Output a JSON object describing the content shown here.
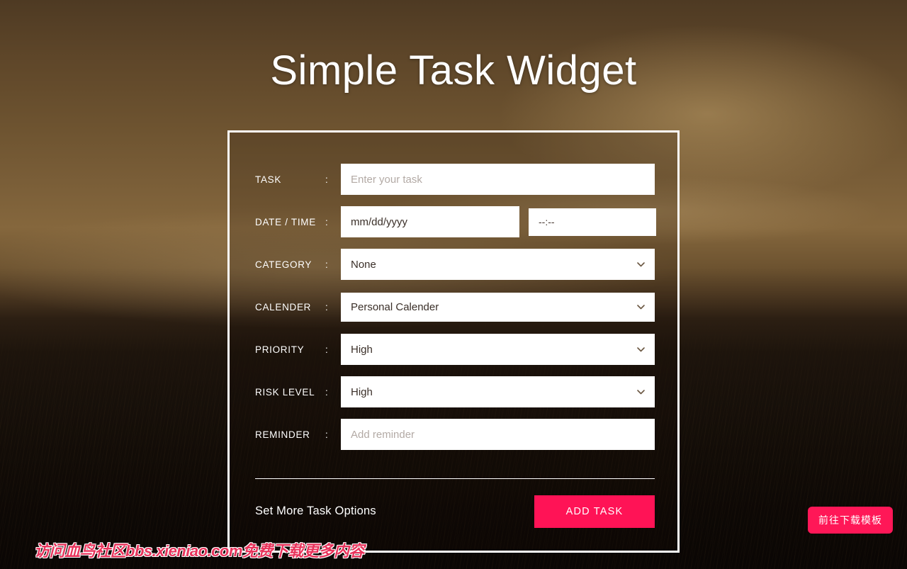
{
  "page": {
    "title": "Simple Task Widget",
    "background_description": "sepia sunset over ocean photo"
  },
  "colors": {
    "accent_pink": "#FF1356",
    "download_button_pink": "#FF1757",
    "card_border": "#FFFFFF",
    "label_text": "#FFFFFF",
    "field_background": "#FFFFFF",
    "field_text": "#3A2F28",
    "placeholder_text": "#B3AAA5",
    "chevron": "#6B5742",
    "watermark_red": "#E8345C"
  },
  "form": {
    "rows": [
      {
        "label": "TASK",
        "colon": ":",
        "type": "text",
        "value": "",
        "placeholder": "Enter your task"
      },
      {
        "label": "DATE / TIME",
        "colon": ":",
        "type": "date-time",
        "date_value": "",
        "date_placeholder": "mm/dd/yyyy",
        "time_value": "",
        "time_placeholder": "--:--"
      },
      {
        "label": "CATEGORY",
        "colon": ":",
        "type": "select",
        "value": "None"
      },
      {
        "label": "CALENDER",
        "colon": ":",
        "type": "select",
        "value": "Personal Calender"
      },
      {
        "label": "PRIORITY",
        "colon": ":",
        "type": "select",
        "value": "High"
      },
      {
        "label": "RISK LEVEL",
        "colon": ":",
        "type": "select",
        "value": "High"
      },
      {
        "label": "REMINDER",
        "colon": ":",
        "type": "text",
        "value": "",
        "placeholder": "Add reminder"
      }
    ]
  },
  "footer": {
    "more_options_label": "Set More Task Options",
    "add_task_label": "ADD TASK"
  },
  "watermarks": {
    "bottom_text": "访问血鸟社区bbs.xieniao.com免费下载更多内容",
    "download_button_label": "前往下载模板"
  },
  "icons": {
    "chevron_down": "chevron-down-icon"
  }
}
